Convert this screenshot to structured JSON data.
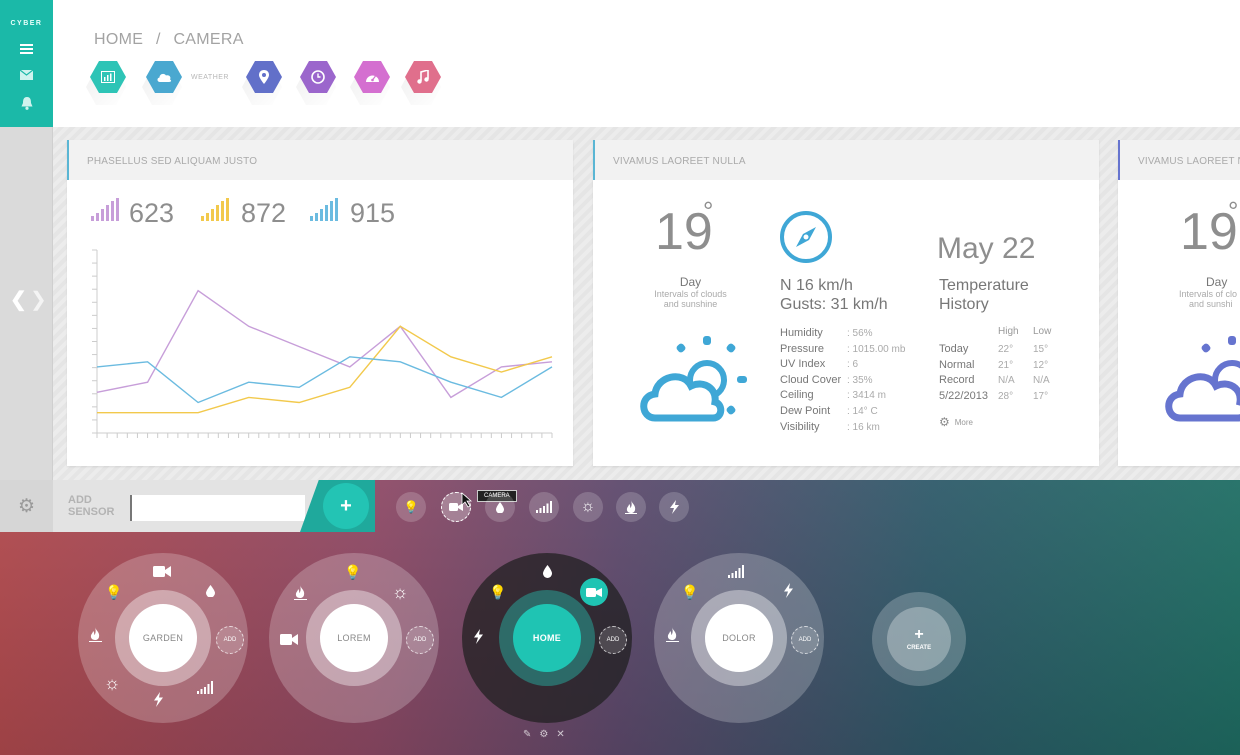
{
  "sidebar": {
    "brand": "CYBER"
  },
  "breadcrumb": {
    "home": "HOME",
    "sep": "/",
    "current": "CAMERA"
  },
  "hex_tabs": [
    {
      "icon": "chart-icon",
      "color": "#2ec4b6"
    },
    {
      "icon": "cloud-icon",
      "color": "#4aa8d0",
      "label": "WEATHER"
    },
    {
      "icon": "pin-icon",
      "color": "#6270c9"
    },
    {
      "icon": "clock-icon",
      "color": "#9b66cc"
    },
    {
      "icon": "dashboard-icon",
      "color": "#d46fd0"
    },
    {
      "icon": "music-icon",
      "color": "#e06f8c"
    }
  ],
  "pager": {
    "prev": "❮",
    "next": "❯"
  },
  "card1": {
    "title": "PHASELLUS SED ALIQUAM JUSTO",
    "stats": [
      {
        "value": "623",
        "color": "#c79ed9"
      },
      {
        "value": "872",
        "color": "#f2c94c"
      },
      {
        "value": "915",
        "color": "#6bbbe0"
      }
    ]
  },
  "chart_data": {
    "type": "line",
    "x": [
      0,
      1,
      2,
      3,
      4,
      5,
      6,
      7,
      8,
      9
    ],
    "series": [
      {
        "color": "#c79ed9",
        "values": [
          4,
          5,
          14,
          10.5,
          8.5,
          6.5,
          10.5,
          3.5,
          6.5,
          7
        ]
      },
      {
        "color": "#f2c94c",
        "values": [
          2,
          2,
          2,
          3.5,
          3,
          4.5,
          10.5,
          7.5,
          6,
          7.5
        ]
      },
      {
        "color": "#6bbbe0",
        "values": [
          6.5,
          7,
          3,
          5,
          4.5,
          7.5,
          7,
          5,
          3.5,
          6.5
        ]
      }
    ],
    "ylim": [
      0,
      18
    ],
    "grid": false
  },
  "card2": {
    "title": "VIVAMUS LAOREET NULLA",
    "temp": "19",
    "deg": "°",
    "day": "Day",
    "desc1": "Intervals of clouds",
    "desc2": "and sunshine",
    "wind": "N 16 km/h",
    "gusts": "Gusts: 31 km/h",
    "details": [
      {
        "k": "Humidity",
        "v": ": 56%"
      },
      {
        "k": "Pressure",
        "v": ": 1015.00 mb"
      },
      {
        "k": "UV Index",
        "v": ": 6"
      },
      {
        "k": "Cloud Cover",
        "v": ": 35%"
      },
      {
        "k": "Ceiling",
        "v": ": 3414 m"
      },
      {
        "k": "Dew Point",
        "v": ": 14° C"
      },
      {
        "k": "Visibility",
        "v": ": 16 km"
      }
    ],
    "date": "May 22",
    "history_title": "Temperature",
    "history_sub": "History",
    "h_high": "High",
    "h_low": "Low",
    "history": [
      {
        "k": "Today",
        "h": "22°",
        "l": "15°"
      },
      {
        "k": "Normal",
        "h": "21°",
        "l": "12°"
      },
      {
        "k": "Record",
        "h": "N/A",
        "l": "N/A"
      },
      {
        "k": "5/22/2013",
        "h": "28°",
        "l": "17°"
      }
    ],
    "more": "More",
    "icon_color": "#3fa7d6"
  },
  "card3": {
    "title": "VIVAMUS LAOREET NULLA",
    "temp": "19",
    "deg": "°",
    "day": "Day",
    "desc1": "Intervals of clo",
    "desc2": "and sunshi",
    "icon_color": "#6674cf"
  },
  "toolbar": {
    "add1": "ADD",
    "add2": "SENSOR",
    "input_value": "",
    "plus": "+",
    "tooltip": "CAMERA",
    "sensors": [
      "bulb-icon",
      "camera-icon",
      "drop-icon",
      "signal-icon",
      "sun-icon",
      "flame-icon",
      "bolt-icon"
    ]
  },
  "hubs": [
    {
      "label": "GARDEN",
      "add": "ADD"
    },
    {
      "label": "LOREM",
      "add": "ADD"
    },
    {
      "label": "HOME",
      "add": "ADD"
    },
    {
      "label": "DOLOR",
      "add": "ADD"
    }
  ],
  "create": {
    "plus": "+",
    "label": "CREATE"
  }
}
